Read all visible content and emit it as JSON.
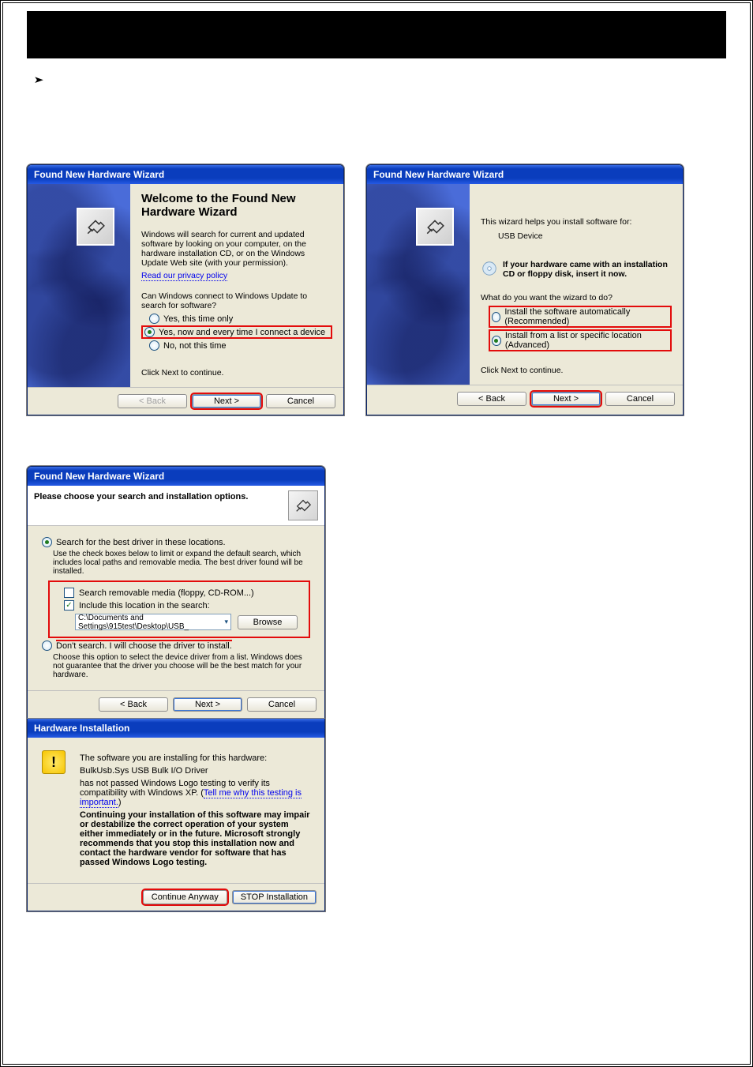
{
  "dialog1": {
    "title": "Found New Hardware Wizard",
    "heading": "Welcome to the Found New Hardware Wizard",
    "desc": "Windows will search for current and updated software by looking on your computer, on the hardware installation CD, or on the Windows Update Web site (with your permission).",
    "privacy": "Read our privacy policy",
    "question": "Can Windows connect to Windows Update to search for software?",
    "opt1": "Yes, this time only",
    "opt2": "Yes, now and every time I connect a device",
    "opt3": "No, not this time",
    "continue": "Click Next to continue.",
    "back": "< Back",
    "next": "Next >",
    "cancel": "Cancel"
  },
  "dialog2": {
    "title": "Found New Hardware Wizard",
    "helps": "This wizard helps you install software for:",
    "device": "USB Device",
    "cdnote": "If your hardware came with an installation CD or floppy disk, insert it now.",
    "question": "What do you want the wizard to do?",
    "optA": "Install the software automatically (Recommended)",
    "optB": "Install from a list or specific location (Advanced)",
    "continue": "Click Next to continue.",
    "back": "< Back",
    "next": "Next >",
    "cancel": "Cancel"
  },
  "dialog3": {
    "title": "Found New Hardware Wizard",
    "header": "Please choose your search and installation options.",
    "optSearch": "Search for the best driver in these locations.",
    "help1": "Use the check boxes below to limit or expand the default search, which includes local paths and removable media. The best driver found will be installed.",
    "chk1": "Search removable media (floppy, CD-ROM...)",
    "chk2": "Include this location in the search:",
    "path": "C:\\Documents and Settings\\915test\\Desktop\\USB_",
    "browse": "Browse",
    "optDont": "Don't search. I will choose the driver to install.",
    "help2": "Choose this option to select the device driver from a list. Windows does not guarantee that the driver you choose will be the best match for your hardware.",
    "back": "< Back",
    "next": "Next >",
    "cancel": "Cancel"
  },
  "dialog4": {
    "title": "Hardware Installation",
    "l1": "The software you are installing for this hardware:",
    "l2": "BulkUsb.Sys USB Bulk I/O Driver",
    "l3a": "has not passed Windows Logo testing to verify its compatibility with Windows XP. (",
    "l3link": "Tell me why this testing is important.",
    "l3b": ")",
    "l4": "Continuing your installation of this software may impair or destabilize the correct operation of your system either immediately or in the future. Microsoft strongly recommends that you stop this installation now and contact the hardware vendor for software that has passed Windows Logo testing.",
    "continueAnyway": "Continue Anyway",
    "stop": "STOP Installation"
  },
  "icons": {
    "hardware": "hardware-device-icon",
    "cdrom": "cdrom-icon",
    "warning": "warning-icon"
  }
}
